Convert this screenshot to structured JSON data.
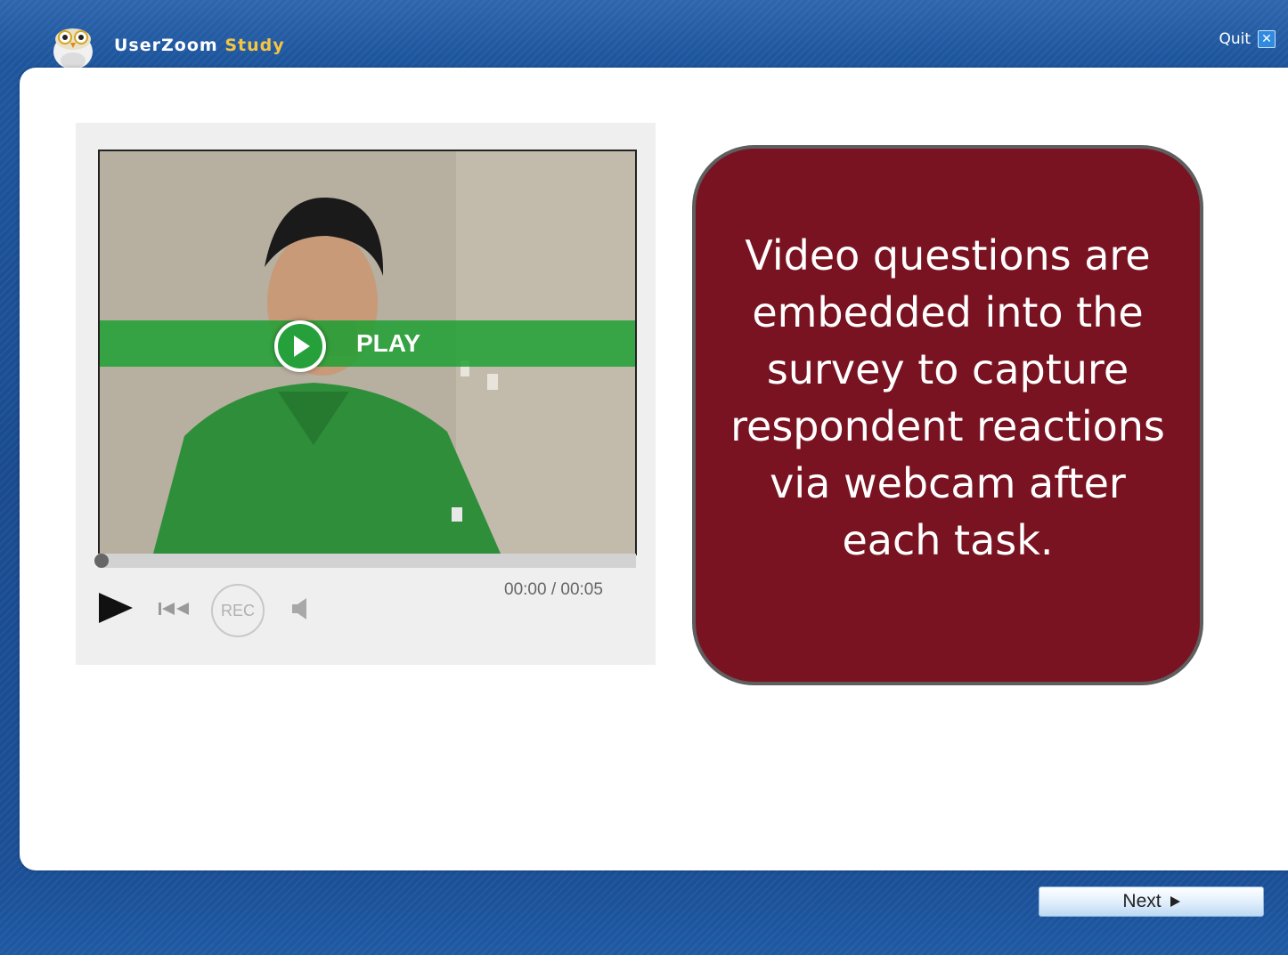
{
  "header": {
    "app_name": "UserZoom",
    "app_suffix": "Study",
    "quit_label": "Quit",
    "quit_icon": "close-icon"
  },
  "player": {
    "play_label": "PLAY",
    "rec_label": "REC",
    "time_current": "00:00",
    "time_separator": " / ",
    "time_total": "00:05",
    "progress": 0,
    "icons": [
      "play-icon",
      "rewind-icon",
      "rec-icon",
      "volume-icon"
    ]
  },
  "callout": {
    "text": "Video questions are embedded into the survey to capture respondent reactions via webcam after each task."
  },
  "footer": {
    "next_label": "Next"
  },
  "colors": {
    "callout_bg": "#7a1321",
    "play_band": "#25a03a",
    "frame_blue": "#1b4f93"
  }
}
